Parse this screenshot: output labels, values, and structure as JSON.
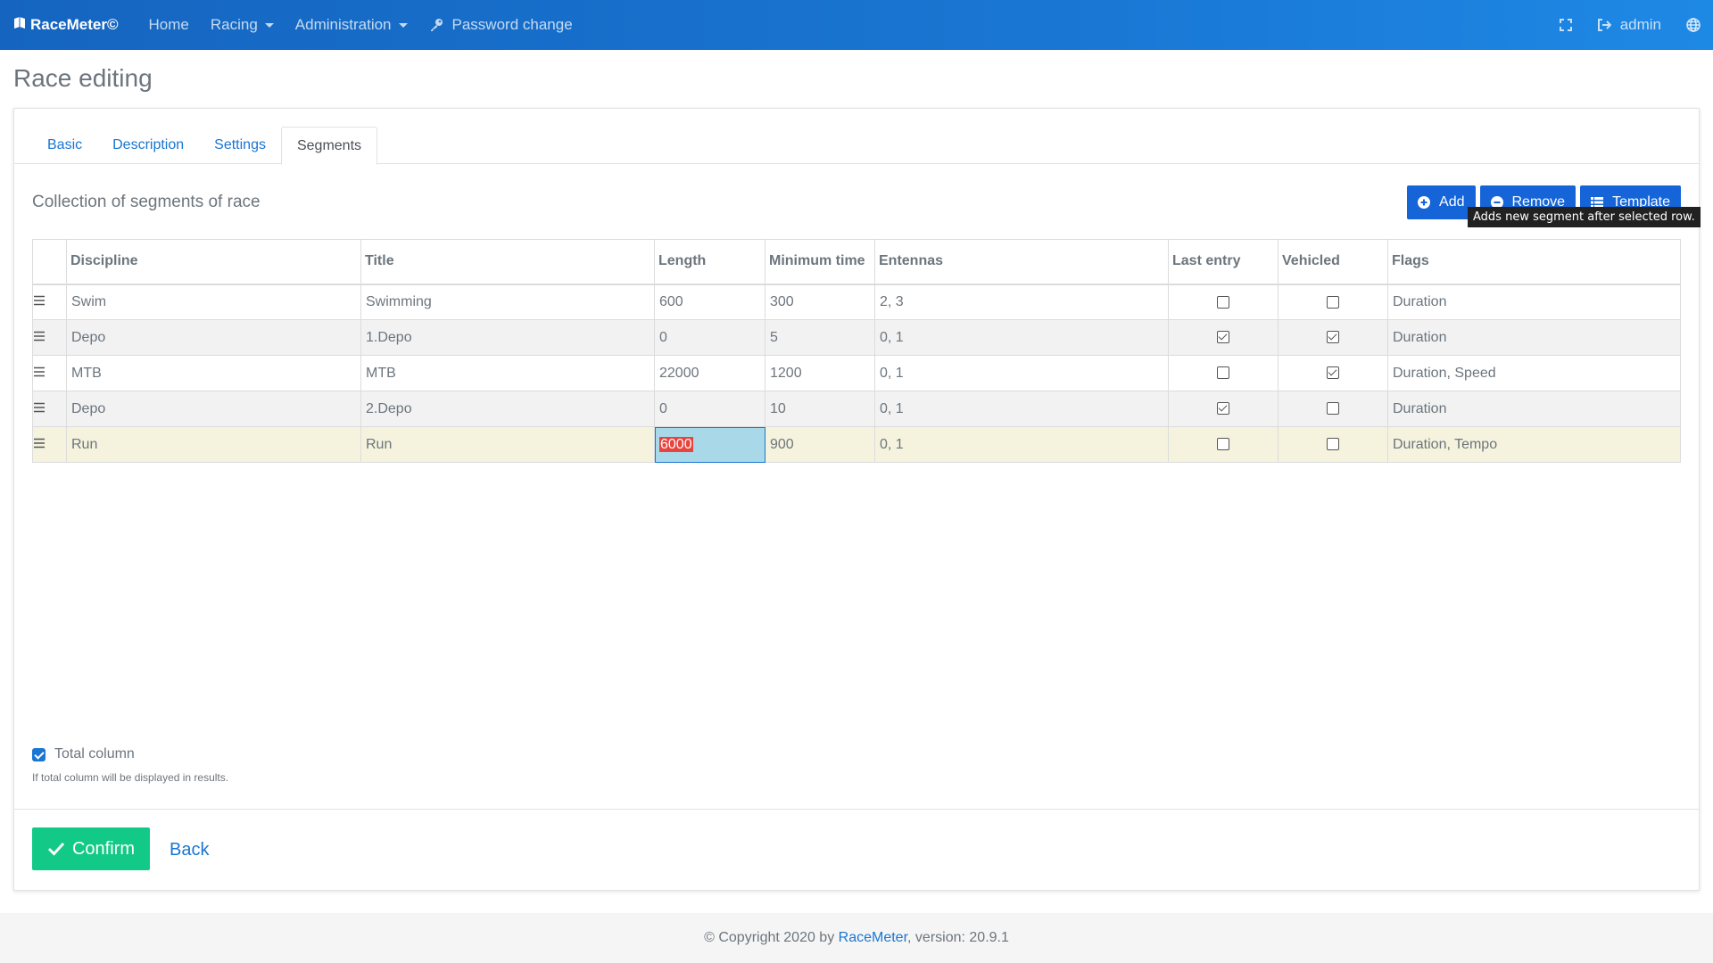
{
  "navbar": {
    "brand": "RaceMeter©",
    "items": [
      {
        "label": "Home"
      },
      {
        "label": "Racing"
      },
      {
        "label": "Administration"
      },
      {
        "label": "Password change"
      }
    ],
    "user": "admin"
  },
  "page": {
    "title": "Race editing"
  },
  "tabs": [
    {
      "label": "Basic"
    },
    {
      "label": "Description"
    },
    {
      "label": "Settings"
    },
    {
      "label": "Segments"
    }
  ],
  "section": {
    "title": "Collection of segments of race"
  },
  "toolbar": {
    "add_label": "Add",
    "remove_label": "Remove",
    "template_label": "Template",
    "tooltip": "Adds new segment after selected row."
  },
  "table": {
    "headers": {
      "discipline": "Discipline",
      "title": "Title",
      "length": "Length",
      "min_time": "Minimum time",
      "antennas": "Entennas",
      "last_entry": "Last entry",
      "vehicled": "Vehicled",
      "flags": "Flags"
    },
    "rows": [
      {
        "discipline": "Swim",
        "title": "Swimming",
        "length": "600",
        "min_time": "300",
        "antennas": "2, 3",
        "last_entry": false,
        "vehicled": false,
        "flags": "Duration"
      },
      {
        "discipline": "Depo",
        "title": "1.Depo",
        "length": "0",
        "min_time": "5",
        "antennas": "0, 1",
        "last_entry": true,
        "vehicled": true,
        "flags": "Duration"
      },
      {
        "discipline": "MTB",
        "title": "MTB",
        "length": "22000",
        "min_time": "1200",
        "antennas": "0, 1",
        "last_entry": false,
        "vehicled": true,
        "flags": "Duration, Speed"
      },
      {
        "discipline": "Depo",
        "title": "2.Depo",
        "length": "0",
        "min_time": "10",
        "antennas": "0, 1",
        "last_entry": true,
        "vehicled": false,
        "flags": "Duration"
      },
      {
        "discipline": "Run",
        "title": "Run",
        "length": "6000",
        "min_time": "900",
        "antennas": "0, 1",
        "last_entry": false,
        "vehicled": false,
        "flags": "Duration, Tempo"
      }
    ]
  },
  "total_column": {
    "label": "Total column",
    "checked": true,
    "help": "If total column will be displayed in results."
  },
  "actions": {
    "confirm_label": "Confirm",
    "back_label": "Back"
  },
  "footer": {
    "prefix": "© Copyright 2020 by ",
    "link": "RaceMeter",
    "suffix": ", version: 20.9.1"
  },
  "colors": {
    "primary": "#1976d2",
    "success": "#12c987",
    "selected_row": "#f5f3de",
    "editing_cell": "#a9d9e8"
  }
}
